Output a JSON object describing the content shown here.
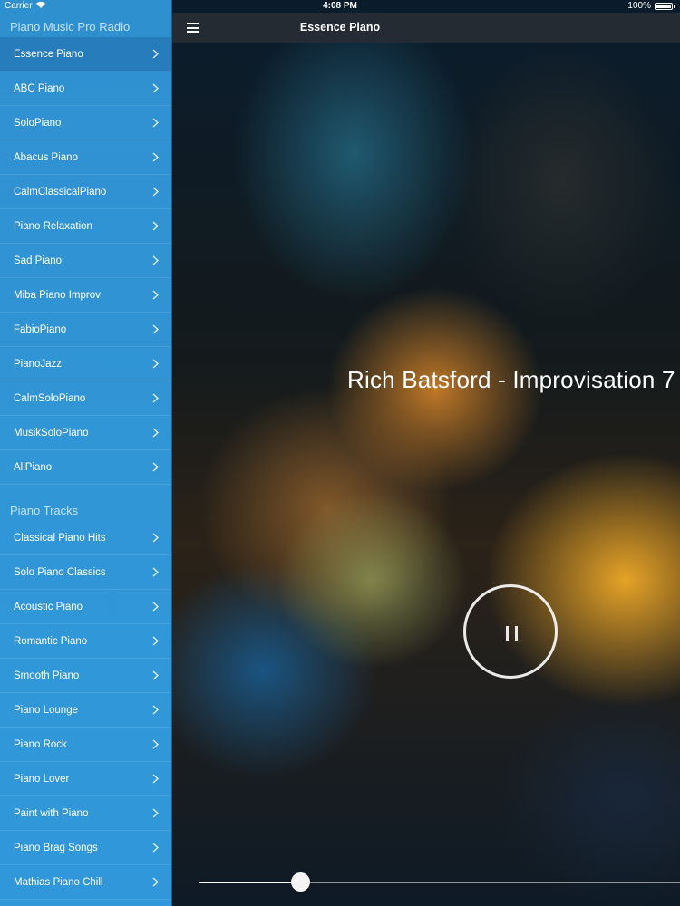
{
  "status_bar": {
    "carrier": "Carrier",
    "time": "4:08 PM",
    "battery": "100%"
  },
  "sidebar": {
    "sections": [
      {
        "title": "Piano Music Pro Radio",
        "items": [
          {
            "label": "Essence Piano",
            "active": true
          },
          {
            "label": "ABC Piano"
          },
          {
            "label": "SoloPiano"
          },
          {
            "label": "Abacus Piano"
          },
          {
            "label": "CalmClassicalPiano"
          },
          {
            "label": "Piano Relaxation"
          },
          {
            "label": "Sad Piano"
          },
          {
            "label": "Miba Piano Improv"
          },
          {
            "label": "FabioPiano"
          },
          {
            "label": "PianoJazz"
          },
          {
            "label": "CalmSoloPiano"
          },
          {
            "label": "MusikSoloPiano"
          },
          {
            "label": "AllPiano"
          }
        ]
      },
      {
        "title": "Piano Tracks",
        "items": [
          {
            "label": "Classical Piano Hits"
          },
          {
            "label": "Solo Piano Classics"
          },
          {
            "label": "Acoustic Piano"
          },
          {
            "label": "Romantic Piano"
          },
          {
            "label": "Smooth Piano"
          },
          {
            "label": "Piano Lounge"
          },
          {
            "label": "Piano Rock"
          },
          {
            "label": "Piano Lover"
          },
          {
            "label": "Paint with Piano"
          },
          {
            "label": "Piano Brag Songs"
          },
          {
            "label": "Mathias Piano Chill"
          }
        ]
      }
    ],
    "chevron_icon": "chevron-right-icon"
  },
  "header": {
    "menu_icon": "hamburger-menu-icon",
    "title": "Essence Piano"
  },
  "player": {
    "now_playing": "Rich Batsford - Improvisation 7",
    "state": "playing",
    "button_icon": "pause-icon",
    "volume": 0.21
  },
  "colors": {
    "sidebar_bg": "#3196d6",
    "topbar_bg": "#262c34",
    "text": "#ffffff"
  }
}
